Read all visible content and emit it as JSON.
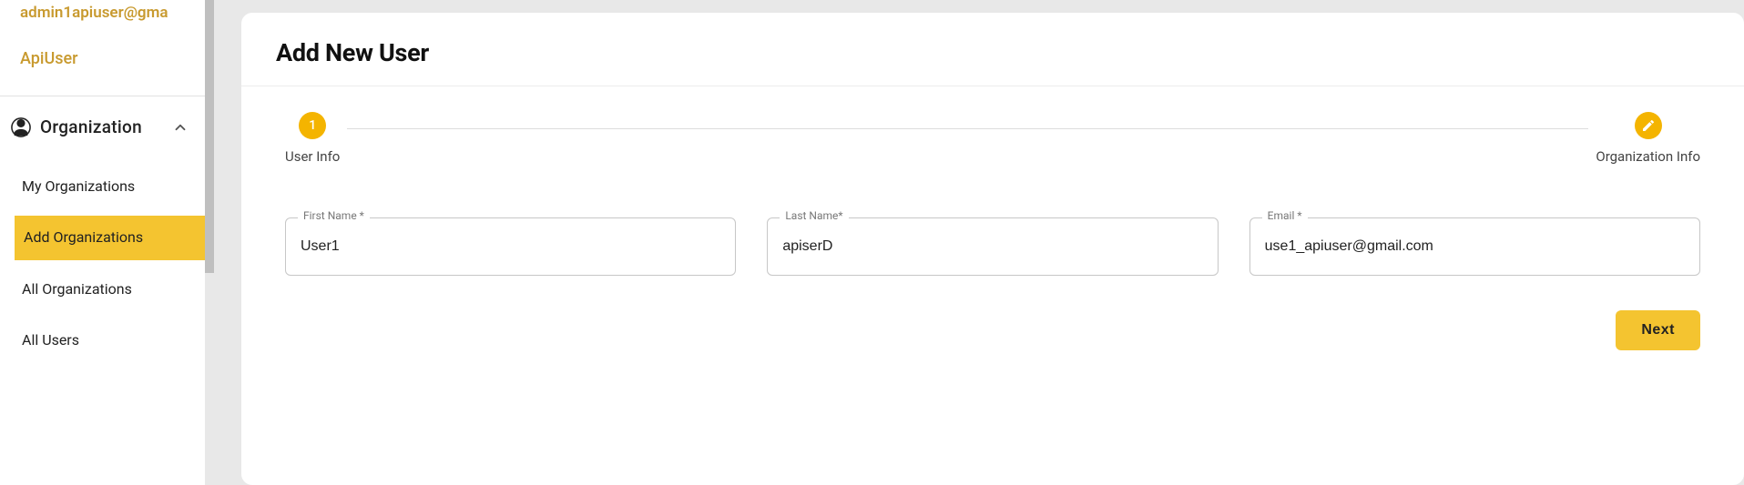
{
  "sidebar": {
    "user_email": "admin1apiuser@gma",
    "user_sub": "ApiUser",
    "section_title": "Organization",
    "items": [
      {
        "label": "My Organizations"
      },
      {
        "label": "Add Organizations"
      },
      {
        "label": "All Organizations"
      },
      {
        "label": "All Users"
      }
    ]
  },
  "main": {
    "title": "Add New User",
    "stepper": {
      "step1_number": "1",
      "step1_label": "User Info",
      "step2_label": "Organization Info"
    },
    "form": {
      "first_name_label": "First Name *",
      "first_name_value": "User1",
      "last_name_label": "Last Name*",
      "last_name_value": "apiserD",
      "email_label": "Email *",
      "email_value": "use1_apiuser@gmail.com"
    },
    "actions": {
      "next_label": "Next"
    }
  }
}
